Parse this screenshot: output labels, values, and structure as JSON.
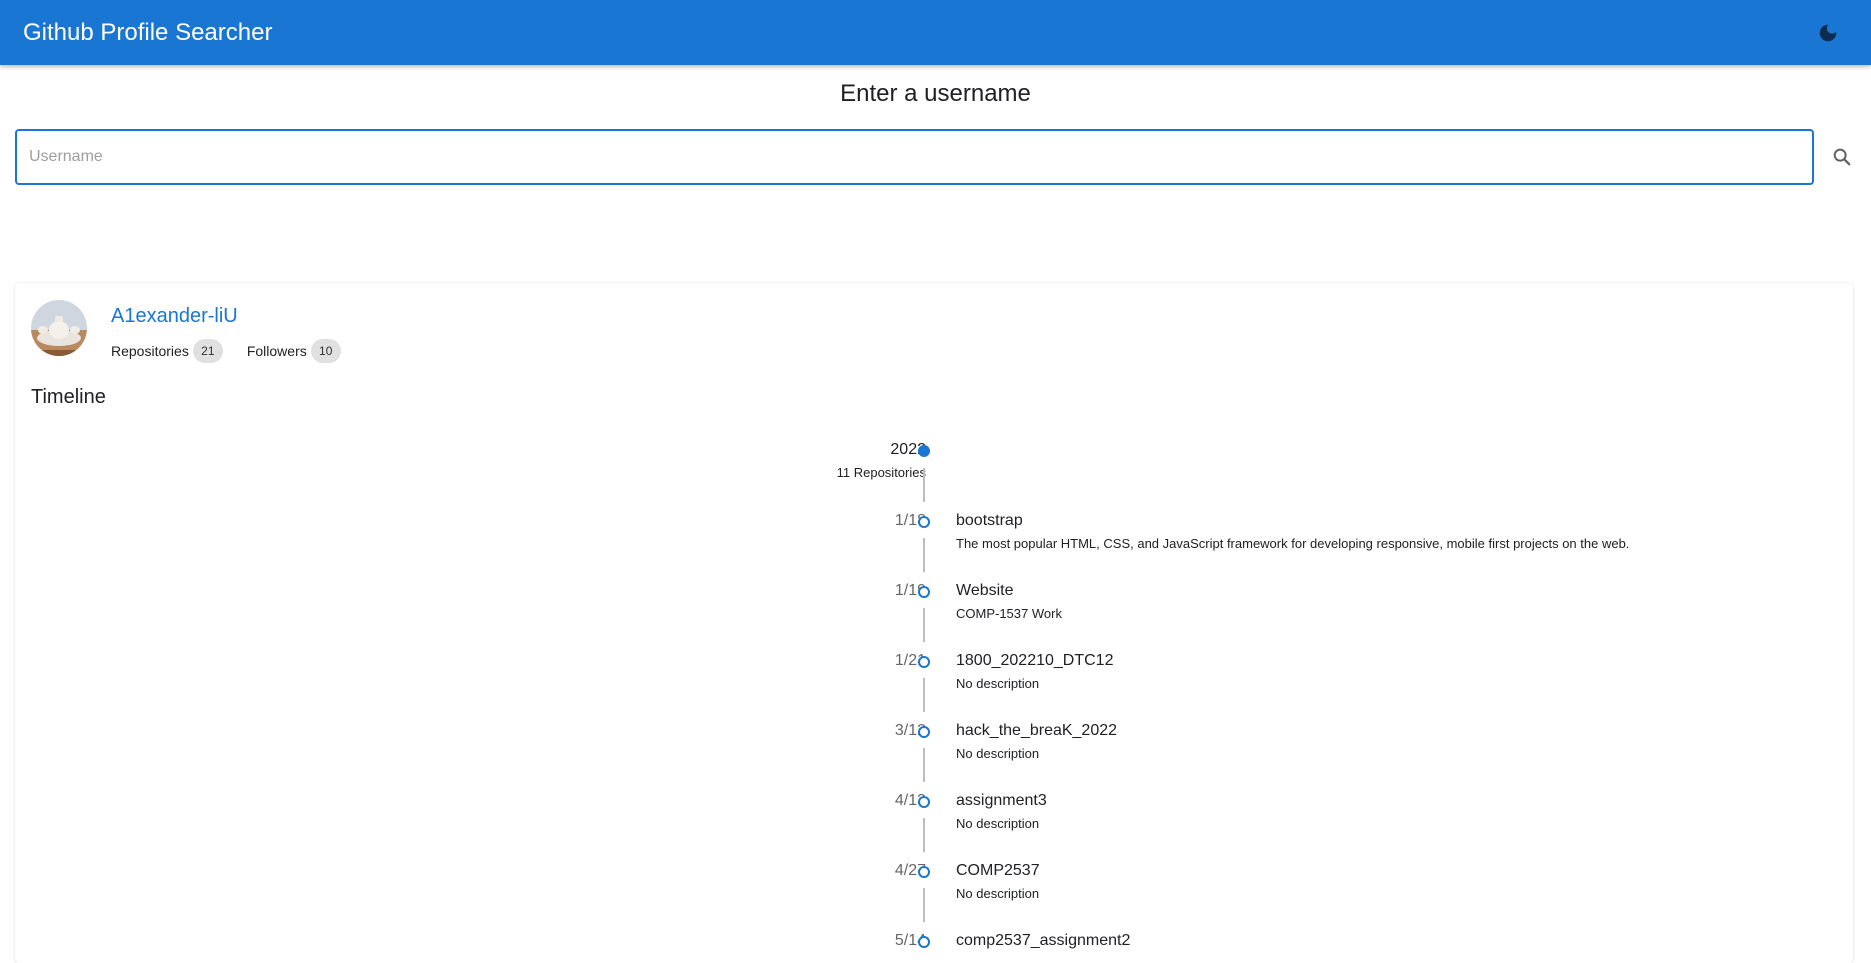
{
  "app": {
    "title": "Github Profile Searcher",
    "theme_toggle_icon": "moon-icon",
    "accent_color": "#1976d2"
  },
  "search": {
    "heading": "Enter a username",
    "placeholder": "Username",
    "value": "",
    "button_icon": "search-icon"
  },
  "profile": {
    "username": "A1exander-liU",
    "repositories_label": "Repositories",
    "repositories_count": "21",
    "followers_label": "Followers",
    "followers_count": "10"
  },
  "timeline": {
    "heading": "Timeline",
    "year": "2022",
    "year_summary": "11 Repositories",
    "items": [
      {
        "date": "1/18",
        "name": "bootstrap",
        "description": "The most popular HTML, CSS, and JavaScript framework for developing responsive, mobile first projects on the web."
      },
      {
        "date": "1/19",
        "name": "Website",
        "description": "COMP-1537 Work"
      },
      {
        "date": "1/21",
        "name": "1800_202210_DTC12",
        "description": "No description"
      },
      {
        "date": "3/12",
        "name": "hack_the_breaK_2022",
        "description": "No description"
      },
      {
        "date": "4/13",
        "name": "assignment3",
        "description": "No description"
      },
      {
        "date": "4/27",
        "name": "COMP2537",
        "description": "No description"
      },
      {
        "date": "5/14",
        "name": "comp2537_assignment2",
        "description": ""
      }
    ]
  }
}
